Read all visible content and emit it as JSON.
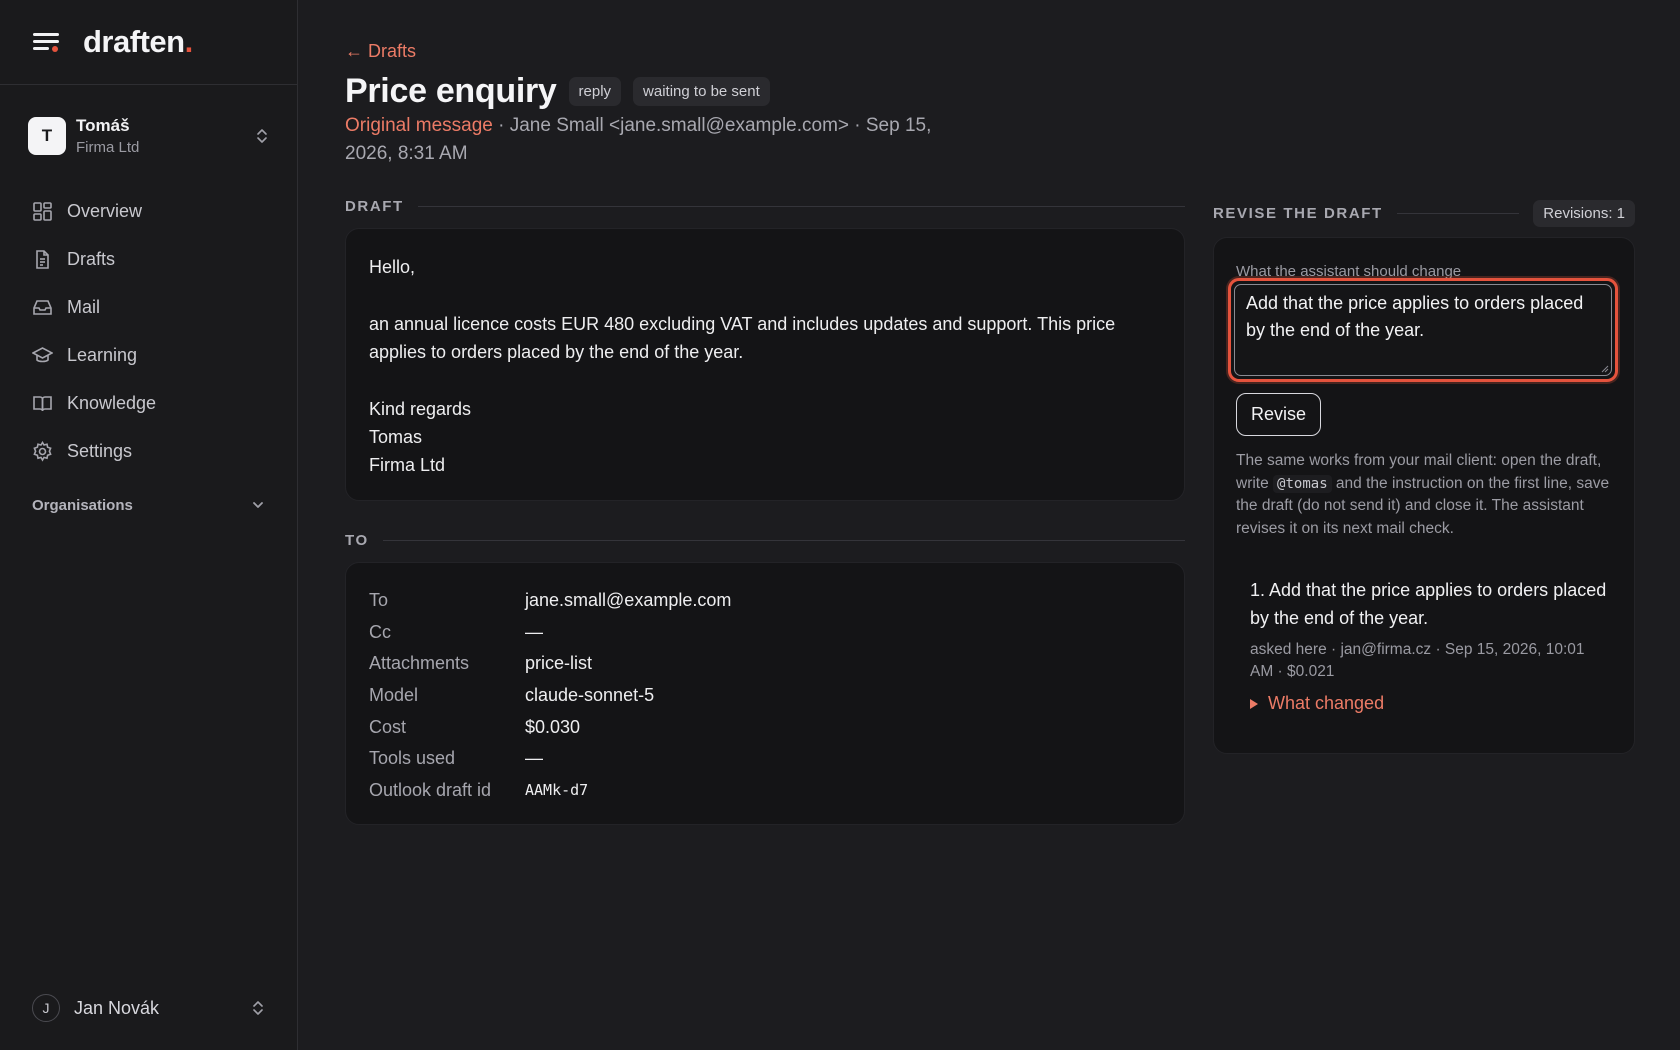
{
  "app": {
    "logo_text": "draften",
    "logo_dot": "."
  },
  "workspace": {
    "avatar_letter": "T",
    "name": "Tomáš",
    "org": "Firma Ltd"
  },
  "nav": {
    "items": [
      {
        "label": "Overview",
        "icon": "grid-icon"
      },
      {
        "label": "Drafts",
        "icon": "document-icon"
      },
      {
        "label": "Mail",
        "icon": "inbox-icon"
      },
      {
        "label": "Learning",
        "icon": "graduation-cap-icon"
      },
      {
        "label": "Knowledge",
        "icon": "book-icon"
      },
      {
        "label": "Settings",
        "icon": "gear-icon"
      }
    ],
    "organisations_label": "Organisations"
  },
  "user": {
    "avatar_letter": "J",
    "name": "Jan Novák"
  },
  "page": {
    "back_link": "← Drafts",
    "title": "Price enquiry",
    "badges": [
      "reply",
      "waiting to be sent"
    ],
    "original_message_label": "Original message",
    "meta_rest": " · Jane Small <jane.small@example.com> · Sep 15, 2026, 8:31 AM"
  },
  "draft": {
    "section_label": "DRAFT",
    "greeting": "Hello,",
    "body_1": "an annual licence costs EUR 480 excluding VAT and includes updates and support. This price",
    "body_2": "applies to orders placed by the end of the year.",
    "closing": "Kind regards",
    "signature_name": "Tomas",
    "signature_org": "Firma Ltd"
  },
  "to": {
    "section_label": "TO",
    "rows": [
      {
        "key": "To",
        "value": "jane.small@example.com"
      },
      {
        "key": "Cc",
        "value": "—"
      },
      {
        "key": "Attachments",
        "value": "price-list"
      },
      {
        "key": "Model",
        "value": "claude-sonnet-5"
      },
      {
        "key": "Cost",
        "value": "$0.030"
      },
      {
        "key": "Tools used",
        "value": "—"
      },
      {
        "key": "Outlook draft id",
        "value": "AAMk-d7"
      }
    ]
  },
  "revise": {
    "section_label": "REVISE THE DRAFT",
    "revisions_badge": "Revisions: 1",
    "field_label": "What the assistant should change",
    "input_value": "Add that the price applies to orders placed by the end of the year.",
    "button_label": "Revise",
    "help_before": "The same works from your mail client: open the draft, write ",
    "help_code": "@tomas",
    "help_after": " and the instruction on the first line, save the draft (do not send it) and close it. The assistant revises it on its next mail check.",
    "history": [
      {
        "title": "1. Add that the price applies to orders placed by the end of the year.",
        "meta": "asked here · jan@firma.cz · Sep 15, 2026, 10:01 AM · $0.021",
        "toggle_label": "What changed"
      }
    ]
  },
  "colors": {
    "accent": "#e5533d",
    "link": "#ec7b66",
    "background": "#1c1c1f",
    "card": "#141416"
  }
}
